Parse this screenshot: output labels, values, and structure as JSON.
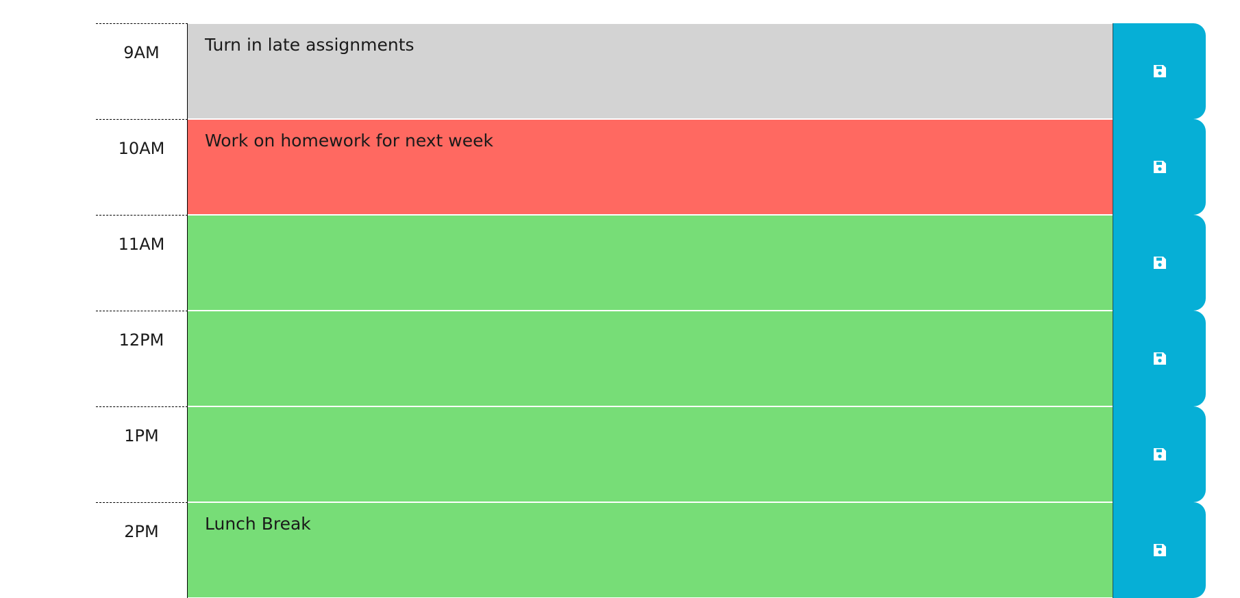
{
  "colors": {
    "past": "#d3d3d3",
    "present": "#ff6961",
    "future": "#77dd77",
    "save_button": "#06afd6"
  },
  "icons": {
    "save": "floppy-disk-icon"
  },
  "rows": [
    {
      "hour": "9AM",
      "description": "Turn in late assignments",
      "state": "past"
    },
    {
      "hour": "10AM",
      "description": "Work on homework for next week",
      "state": "present"
    },
    {
      "hour": "11AM",
      "description": "",
      "state": "future"
    },
    {
      "hour": "12PM",
      "description": "",
      "state": "future"
    },
    {
      "hour": "1PM",
      "description": "",
      "state": "future"
    },
    {
      "hour": "2PM",
      "description": "Lunch Break",
      "state": "future"
    }
  ]
}
